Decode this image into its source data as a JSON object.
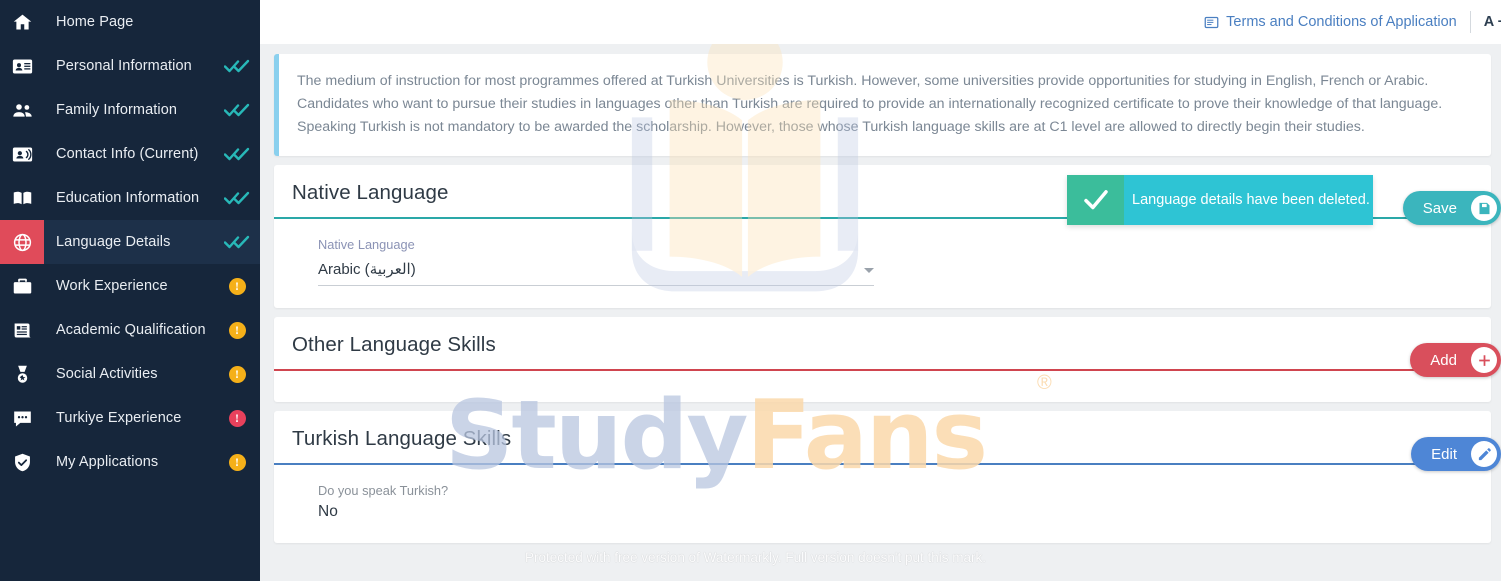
{
  "sidebar": {
    "items": [
      {
        "label": "Home Page",
        "icon": "home-icon",
        "status": "none",
        "active": false
      },
      {
        "label": "Personal Information",
        "icon": "id-card-icon",
        "status": "complete",
        "active": false
      },
      {
        "label": "Family Information",
        "icon": "people-icon",
        "status": "complete",
        "active": false
      },
      {
        "label": "Contact Info (Current)",
        "icon": "contact-card-icon",
        "status": "complete",
        "active": false
      },
      {
        "label": "Education Information",
        "icon": "book-icon",
        "status": "complete",
        "active": false
      },
      {
        "label": "Language Details",
        "icon": "globe-icon",
        "status": "complete",
        "active": true
      },
      {
        "label": "Work Experience",
        "icon": "briefcase-icon",
        "status": "warning",
        "active": false
      },
      {
        "label": "Academic Qualification",
        "icon": "certificate-icon",
        "status": "warning",
        "active": false
      },
      {
        "label": "Social Activities",
        "icon": "medal-icon",
        "status": "warning",
        "active": false
      },
      {
        "label": "Turkiye Experience",
        "icon": "chat-icon",
        "status": "error",
        "active": false
      },
      {
        "label": "My Applications",
        "icon": "shield-check-icon",
        "status": "warning",
        "active": false
      }
    ],
    "status_symbols": {
      "warning": "!",
      "error": "!"
    }
  },
  "topbar": {
    "terms_link": "Terms and Conditions of Application",
    "terms_icon": "document-icon",
    "font_size_control": "A +/-"
  },
  "notice": {
    "text": "The medium of instruction for most programmes offered at Turkish Universities is Turkish. However, some universities provide opportunities for studying in English, French or Arabic. Candidates who want to pursue their studies in languages other than Turkish are required to provide an internationally recognized certificate to prove their knowledge of that language. Speaking Turkish is not mandatory to be awarded the scholarship. However, those whose Turkish language skills are at C1 level are allowed to directly begin their studies."
  },
  "toast": {
    "message": "Language details have been deleted.",
    "icon": "check-icon",
    "body_color": "#2ec4d4",
    "icon_color": "#3bbd9b"
  },
  "sections": {
    "native_language": {
      "title": "Native Language",
      "rule_color": "#2aa8a8",
      "field_label": "Native Language",
      "field_value": "Arabic (العربية)",
      "action": {
        "label": "Save",
        "icon": "save-icon",
        "color": "#3bb5bd"
      }
    },
    "other_language_skills": {
      "title": "Other Language Skills",
      "rule_color": "#d0454f",
      "action": {
        "label": "Add",
        "icon": "plus-icon",
        "color": "#d94f5c"
      }
    },
    "turkish_language_skills": {
      "title": "Turkish Language Skills",
      "rule_color": "#4a7fc1",
      "question_label": "Do you speak Turkish?",
      "question_value": "No",
      "action": {
        "label": "Edit",
        "icon": "pencil-icon",
        "color": "#4e86d6"
      }
    }
  },
  "watermarks": {
    "brand_part1": "Study",
    "brand_part2": "Fans",
    "registered": "®",
    "footer": "Protected with free version of Watermarkly. Full version doesn't put this mark."
  }
}
